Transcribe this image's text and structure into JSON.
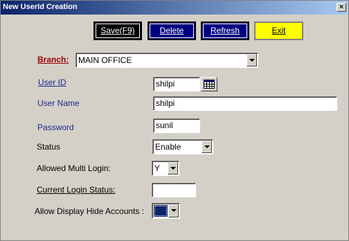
{
  "window": {
    "title": "New UserId Creation",
    "close_glyph": "×"
  },
  "toolbar": {
    "save_label": "Save(F9)",
    "delete_label": "Delete",
    "refresh_label": "Refresh",
    "exit_label": "Exit"
  },
  "form": {
    "branch": {
      "label": "Branch:",
      "value": "MAIN OFFICE"
    },
    "user_id": {
      "label": "User ID",
      "value": "shilpi",
      "lookup_icon": "grid-icon"
    },
    "user_name": {
      "label": "User Name",
      "value": "shilpi"
    },
    "password": {
      "label": "Password",
      "value": "sunil"
    },
    "status": {
      "label": "Status",
      "value": "Enable"
    },
    "allowed_multi_login": {
      "label": "Allowed Multi Login:",
      "value": "Y"
    },
    "current_login_status": {
      "label": "Current Login Status:",
      "value": ""
    },
    "allow_display_hide_accounts": {
      "label": "Allow Display Hide Accounts :",
      "value": ""
    }
  },
  "colors": {
    "titlebar_start": "#0a246a",
    "titlebar_end": "#a6caf0",
    "button_dark": "#000080",
    "exit_button": "#ffff00",
    "branch_label": "#990000"
  }
}
